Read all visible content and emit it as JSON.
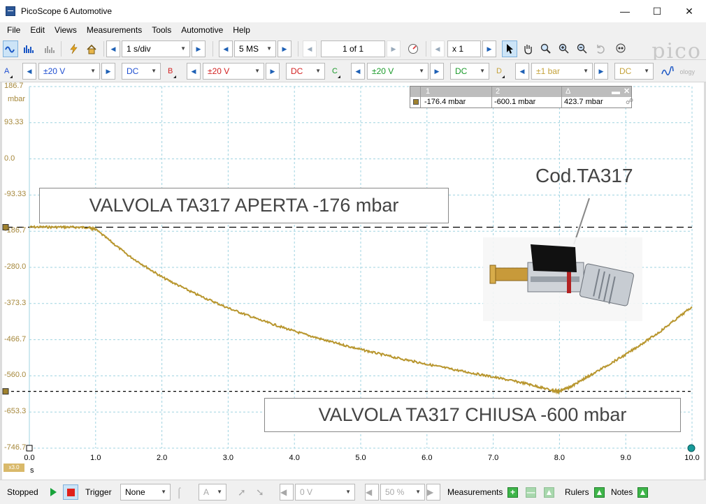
{
  "window": {
    "title": "PicoScope 6 Automotive",
    "controls": [
      "minimize-icon",
      "maximize-icon",
      "close-icon"
    ]
  },
  "menu": [
    "File",
    "Edit",
    "Views",
    "Measurements",
    "Tools",
    "Automotive",
    "Help"
  ],
  "toolbar": {
    "timebase": "1 s/div",
    "samples": "5 MS",
    "buffer": "1 of 1",
    "zoom": "x 1",
    "logo": "pico",
    "logo_sub": "ology"
  },
  "channels": [
    {
      "id": "A",
      "range": "±20 V",
      "coupling": "DC",
      "color": "#1f4fd1"
    },
    {
      "id": "B",
      "range": "±20 V",
      "coupling": "DC",
      "color": "#d22222"
    },
    {
      "id": "C",
      "range": "±20 V",
      "coupling": "DC",
      "color": "#1a9a2a"
    },
    {
      "id": "D",
      "range": "±1 bar",
      "coupling": "DC",
      "color": "#c4a23a"
    }
  ],
  "chart_data": {
    "type": "line",
    "yunit": "mbar",
    "xunit": "s",
    "xscale_badge": "x3.0",
    "yticks": [
      "186.7",
      "93.33",
      "0.0",
      "-93.33",
      "-186.7",
      "-280.0",
      "-373.3",
      "-466.7",
      "-560.0",
      "-653.3",
      "-746.7"
    ],
    "xticks": [
      "0.0",
      "1.0",
      "2.0",
      "3.0",
      "4.0",
      "5.0",
      "6.0",
      "7.0",
      "8.0",
      "9.0",
      "10.0"
    ],
    "xlim": [
      0,
      10
    ],
    "ylim": [
      -746.7,
      186.7
    ],
    "grid": true,
    "series": [
      {
        "color": "#b8962e",
        "x": [
          0,
          0.5,
          0.9,
          1.0,
          1.5,
          2.0,
          2.5,
          3.0,
          3.5,
          4.0,
          4.5,
          5.0,
          5.5,
          6.0,
          6.5,
          7.0,
          7.5,
          7.9,
          8.0,
          8.2,
          8.5,
          9.0,
          9.5,
          10.0
        ],
        "y": [
          -176,
          -176,
          -177,
          -182,
          -250,
          -305,
          -348,
          -385,
          -417,
          -445,
          -470,
          -492,
          -512,
          -530,
          -547,
          -563,
          -580,
          -598,
          -600,
          -585,
          -555,
          -505,
          -448,
          -382
        ]
      }
    ],
    "rulers": [
      {
        "label": "1",
        "value": -176.4
      },
      {
        "label": "2",
        "value": -600.1
      }
    ]
  },
  "ruler_table": {
    "headers": [
      "1",
      "2",
      "Δ"
    ],
    "values": [
      "-176.4 mbar",
      "-600.1 mbar",
      "423.7 mbar"
    ]
  },
  "annotations": {
    "open": "VALVOLA TA317 APERTA -176 mbar",
    "closed": "VALVOLA TA317 CHIUSA -600 mbar",
    "code": "Cod.TA317"
  },
  "statusbar": {
    "state": "Stopped",
    "trigger_label": "Trigger",
    "trigger_mode": "None",
    "trigger_channel": "A",
    "trigger_level": "0 V",
    "pretrigger": "50 %",
    "measurements": "Measurements",
    "rulers": "Rulers",
    "notes": "Notes"
  }
}
